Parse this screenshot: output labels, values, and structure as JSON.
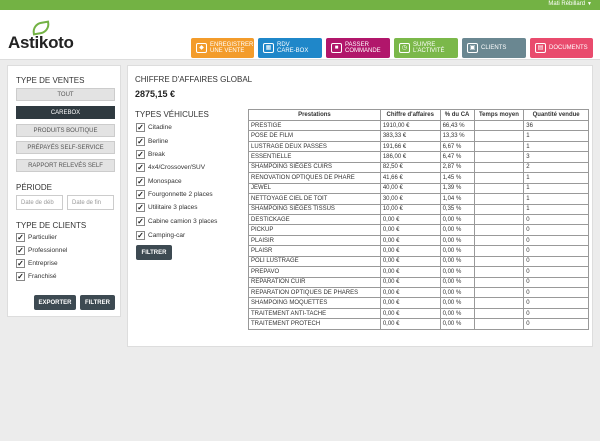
{
  "topbar": {
    "user_name": "Mati Rébillard"
  },
  "brand": {
    "name": "Astikoto",
    "accent": "#73b244"
  },
  "nav": [
    {
      "id": "enregistrer",
      "label_1": "ENREGISTRER",
      "label_2": "UNE VENTE",
      "icon": "car-icon",
      "color": "#f39c2b"
    },
    {
      "id": "rdv",
      "label_1": "RDV",
      "label_2": "CARE-BOX",
      "icon": "calendar-icon",
      "color": "#1f87c9"
    },
    {
      "id": "commande",
      "label_1": "PASSER",
      "label_2": "COMMANDE",
      "icon": "cart-icon",
      "color": "#b1166b"
    },
    {
      "id": "suivre",
      "label_1": "SUIVRE",
      "label_2": "L'ACTIVITÉ",
      "icon": "activity-icon",
      "color": "#7bb84a"
    },
    {
      "id": "clients",
      "label_1": "CLIENTS",
      "label_2": "",
      "icon": "clients-icon",
      "color": "#6a8791"
    },
    {
      "id": "documents",
      "label_1": "DOCUMENTS",
      "label_2": "",
      "icon": "document-icon",
      "color": "#e94b6d"
    }
  ],
  "sidebar": {
    "type_ventes_title": "TYPE DE VENTES",
    "type_ventes": [
      {
        "label": "TOUT",
        "active": false
      },
      {
        "label": "CAREBOX",
        "active": true
      },
      {
        "label": "PRODUITS BOUTIQUE",
        "active": false
      },
      {
        "label": "PRÉPAYÉS SELF-SERVICE",
        "active": false
      },
      {
        "label": "RAPPORT RELEVÉS SELF",
        "active": false
      }
    ],
    "periode_title": "PÉRIODE",
    "date_debut_placeholder": "Date de déb",
    "date_fin_placeholder": "Date de fin",
    "type_clients_title": "TYPE DE CLIENTS",
    "clients": [
      {
        "label": "Particulier",
        "checked": true
      },
      {
        "label": "Professionnel",
        "checked": true
      },
      {
        "label": "Entreprise",
        "checked": true
      },
      {
        "label": "Franchisé",
        "checked": true
      }
    ],
    "export_label": "EXPORTER",
    "filtrer_label": "FILTRER"
  },
  "main": {
    "ca_title": "CHIFFRE D'AFFAIRES GLOBAL",
    "ca_value": "2875,15 €",
    "types_title": "TYPES VÉHICULES",
    "vehicles": [
      {
        "label": "Citadine",
        "checked": true
      },
      {
        "label": "Berline",
        "checked": true
      },
      {
        "label": "Break",
        "checked": true
      },
      {
        "label": "4x4/Crossover/SUV",
        "checked": true
      },
      {
        "label": "Monospace",
        "checked": true
      },
      {
        "label": "Fourgonnette 2 places",
        "checked": true
      },
      {
        "label": "Utilitaire 3 places",
        "checked": true
      },
      {
        "label": "Cabine camion 3 places",
        "checked": true
      },
      {
        "label": "Camping-car",
        "checked": true
      }
    ],
    "filtrer_label": "FILTRER",
    "table": {
      "headers": [
        "Prestations",
        "Chiffre d'affaires",
        "% du CA",
        "Temps moyen",
        "Quantité vendue"
      ],
      "rows": [
        [
          "PRESTIGE",
          "1910,00 €",
          "66,43 %",
          "",
          "36"
        ],
        [
          "POSE DE FILM",
          "383,33 €",
          "13,33 %",
          "",
          "1"
        ],
        [
          "LUSTRAGE DEUX PASSES",
          "191,66 €",
          "6,67 %",
          "",
          "1"
        ],
        [
          "ESSENTIELLE",
          "186,00 €",
          "6,47 %",
          "",
          "3"
        ],
        [
          "SHAMPOING SIÈGES CUIRS",
          "82,50 €",
          "2,87 %",
          "",
          "2"
        ],
        [
          "RENOVATION OPTIQUES DE PHARE",
          "41,66 €",
          "1,45 %",
          "",
          "1"
        ],
        [
          "JEWEL",
          "40,00 €",
          "1,39 %",
          "",
          "1"
        ],
        [
          "NETTOYAGE CIEL DE TOIT",
          "30,00 €",
          "1,04 %",
          "",
          "1"
        ],
        [
          "SHAMPOING SIÈGES TISSUS",
          "10,00 €",
          "0,35 %",
          "",
          "1"
        ],
        [
          "DESTICKAGE",
          "0,00 €",
          "0,00 %",
          "",
          "0"
        ],
        [
          "PICKUP",
          "0,00 €",
          "0,00 %",
          "",
          "0"
        ],
        [
          "PLAISIR",
          "0,00 €",
          "0,00 %",
          "",
          "0"
        ],
        [
          "PLAISR",
          "0,00 €",
          "0,00 %",
          "",
          "0"
        ],
        [
          "POLI LUSTRAGE",
          "0,00 €",
          "0,00 %",
          "",
          "0"
        ],
        [
          "PREPAVO",
          "0,00 €",
          "0,00 %",
          "",
          "0"
        ],
        [
          "REPARATION CUIR",
          "0,00 €",
          "0,00 %",
          "",
          "0"
        ],
        [
          "REPARATION OPTIQUES DE PHARES",
          "0,00 €",
          "0,00 %",
          "",
          "0"
        ],
        [
          "SHAMPOING MOQUETTES",
          "0,00 €",
          "0,00 %",
          "",
          "0"
        ],
        [
          "TRAITEMENT ANTI-TACHE",
          "0,00 €",
          "0,00 %",
          "",
          "0"
        ],
        [
          "TRAITEMENT PROTECH",
          "0,00 €",
          "0,00 %",
          "",
          "0"
        ]
      ]
    }
  }
}
